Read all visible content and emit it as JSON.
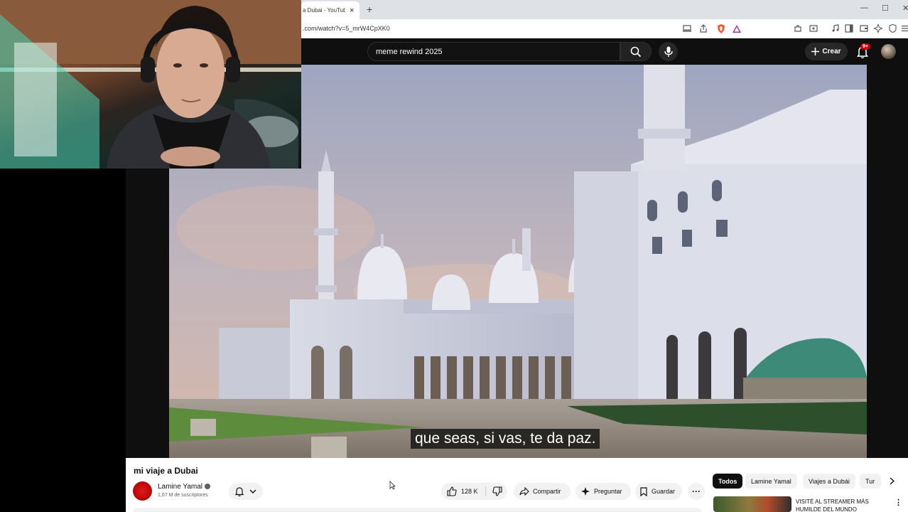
{
  "browser": {
    "tab_title": "a Dubai - YouTube",
    "tab_close": "×",
    "new_tab": "+",
    "url": ".com/watch?v=5_mrW4CpXK0",
    "window_controls": [
      "—",
      "☐",
      "✕"
    ]
  },
  "header": {
    "search_query": "meme rewind 2025",
    "create_label": "Crear",
    "notification_count": "9+"
  },
  "video": {
    "caption": "que seas, si vas, te da paz."
  },
  "info": {
    "title": "mi viaje a Dubai",
    "channel_name": "Lamine Yamal",
    "subscribers": "1,67 M de suscriptores",
    "likes": "128 K",
    "share_label": "Compartir",
    "ask_label": "Preguntar",
    "save_label": "Guardar",
    "more_label": "···"
  },
  "chips": [
    "Todos",
    "Lamine Yamal",
    "Viajes a Dubái",
    "Tur"
  ],
  "recommendation": {
    "title": "VISITÉ AL STREAMER MÁS HUMILDE DEL MUNDO"
  },
  "colors": {
    "yt_dark": "#0f0f0f",
    "badge_red": "#cc0000",
    "brave_orange": "#fb542b",
    "caption_bg": "#080808"
  },
  "icons": {
    "search": "search-icon",
    "mic": "mic-icon",
    "bell": "bell-icon",
    "like": "thumbs-up-icon",
    "dislike": "thumbs-down-icon",
    "share": "share-arrow-icon",
    "ask": "sparkle-icon",
    "save": "bookmark-icon"
  }
}
